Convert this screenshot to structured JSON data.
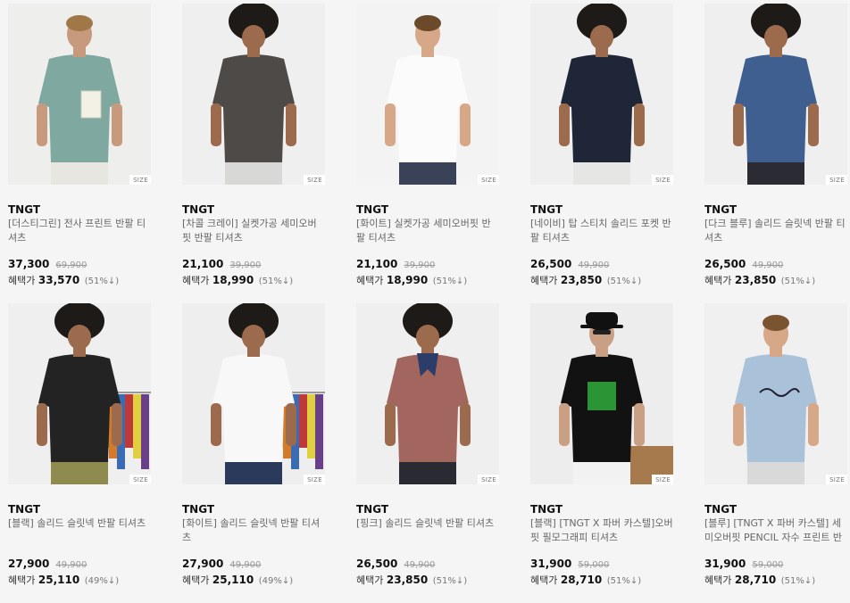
{
  "size_tag": "SIZE",
  "benefit_label": "혜택가",
  "products": [
    {
      "brand": "TNGT",
      "name": "[더스티그린] 전사 프린트 반팔 티셔츠",
      "price": "37,300",
      "original": "69,900",
      "benefit_price": "33,570",
      "percent": "(51%↓)",
      "colors": {
        "bg": "#eeeeec",
        "shirt": "#7fa8a1",
        "pants": "#e8e6e0",
        "skin": "#c79a7e",
        "hair": "#a07848",
        "print": "#f3f0e6"
      }
    },
    {
      "brand": "TNGT",
      "name": "[차콜 크레이] 실켓가공 세미오버핏 반팔 티셔츠",
      "price": "21,100",
      "original": "39,900",
      "benefit_price": "18,990",
      "percent": "(51%↓)",
      "colors": {
        "bg": "#efefef",
        "shirt": "#4d4a47",
        "pants": "#d8d8d6",
        "skin": "#9c6b4e",
        "hair": "#1e1a17"
      }
    },
    {
      "brand": "TNGT",
      "name": "[화이트] 실켓가공 세미오버핏 반팔 티셔츠",
      "price": "21,100",
      "original": "39,900",
      "benefit_price": "18,990",
      "percent": "(51%↓)",
      "colors": {
        "bg": "#f3f3f3",
        "shirt": "#fbfbfb",
        "pants": "#3a4257",
        "skin": "#d6a888",
        "hair": "#6b4a2c"
      }
    },
    {
      "brand": "TNGT",
      "name": "[네이비] 탑 스티치 솔리드 포켓 반팔 티셔츠",
      "price": "26,500",
      "original": "49,900",
      "benefit_price": "23,850",
      "percent": "(51%↓)",
      "colors": {
        "bg": "#efefef",
        "shirt": "#1f2638",
        "pants": "#e6e6e4",
        "skin": "#9c6b4e",
        "hair": "#1e1a17"
      }
    },
    {
      "brand": "TNGT",
      "name": "[다크 블루] 솔리드 슬릿넥 반팔 티셔츠",
      "price": "26,500",
      "original": "49,900",
      "benefit_price": "23,850",
      "percent": "(51%↓)",
      "colors": {
        "bg": "#efefef",
        "shirt": "#3e5f8f",
        "pants": "#2b2b33",
        "skin": "#9c6b4e",
        "hair": "#1e1a17"
      }
    },
    {
      "brand": "TNGT",
      "name": "[블랙] 솔리드 슬릿넥 반팔 티셔츠",
      "price": "27,900",
      "original": "49,900",
      "benefit_price": "25,110",
      "percent": "(49%↓)",
      "colors": {
        "bg": "#efefef",
        "shirt": "#232323",
        "pants": "#8f8a4d",
        "skin": "#9c6b4e",
        "hair": "#1e1a17",
        "rack": true
      }
    },
    {
      "brand": "TNGT",
      "name": "[화이트] 솔리드 슬릿넥 반팔 티셔츠",
      "price": "27,900",
      "original": "49,900",
      "benefit_price": "25,110",
      "percent": "(49%↓)",
      "colors": {
        "bg": "#eeeeee",
        "shirt": "#f8f8f8",
        "pants": "#2b3a5a",
        "skin": "#9c6b4e",
        "hair": "#1e1a17",
        "rack": true
      }
    },
    {
      "brand": "TNGT",
      "name": "[핑크] 솔리드 슬릿넥 반팔 티셔츠",
      "price": "26,500",
      "original": "49,900",
      "benefit_price": "23,850",
      "percent": "(51%↓)",
      "colors": {
        "bg": "#efefef",
        "shirt": "#a3665e",
        "pants": "#2a2a33",
        "skin": "#9c6b4e",
        "hair": "#1e1a17",
        "scarf": "#2d3d6a"
      }
    },
    {
      "brand": "TNGT",
      "name": "[블랙] [TNGT X 파버 카스텔]오버핏 필모그래피 티셔츠",
      "price": "31,900",
      "original": "59,000",
      "benefit_price": "28,710",
      "percent": "(51%↓)",
      "colors": {
        "bg": "#ededed",
        "shirt": "#121212",
        "pants": "#f2f2f2",
        "skin": "#c9a084",
        "hair": "#111111",
        "graphic": "#2fa33a",
        "hat": true
      }
    },
    {
      "brand": "TNGT",
      "name": "[블루] [TNGT X 파버 카스텔] 세미오버핏 PENCIL 자수 프린트 반팔 티셔츠",
      "price": "31,900",
      "original": "59,000",
      "benefit_price": "28,710",
      "percent": "(51%↓)",
      "colors": {
        "bg": "#f0f0f0",
        "shirt": "#a9c1d9",
        "pants": "#d9d9d9",
        "skin": "#d6a888",
        "hair": "#7a5330",
        "script": true
      }
    }
  ]
}
